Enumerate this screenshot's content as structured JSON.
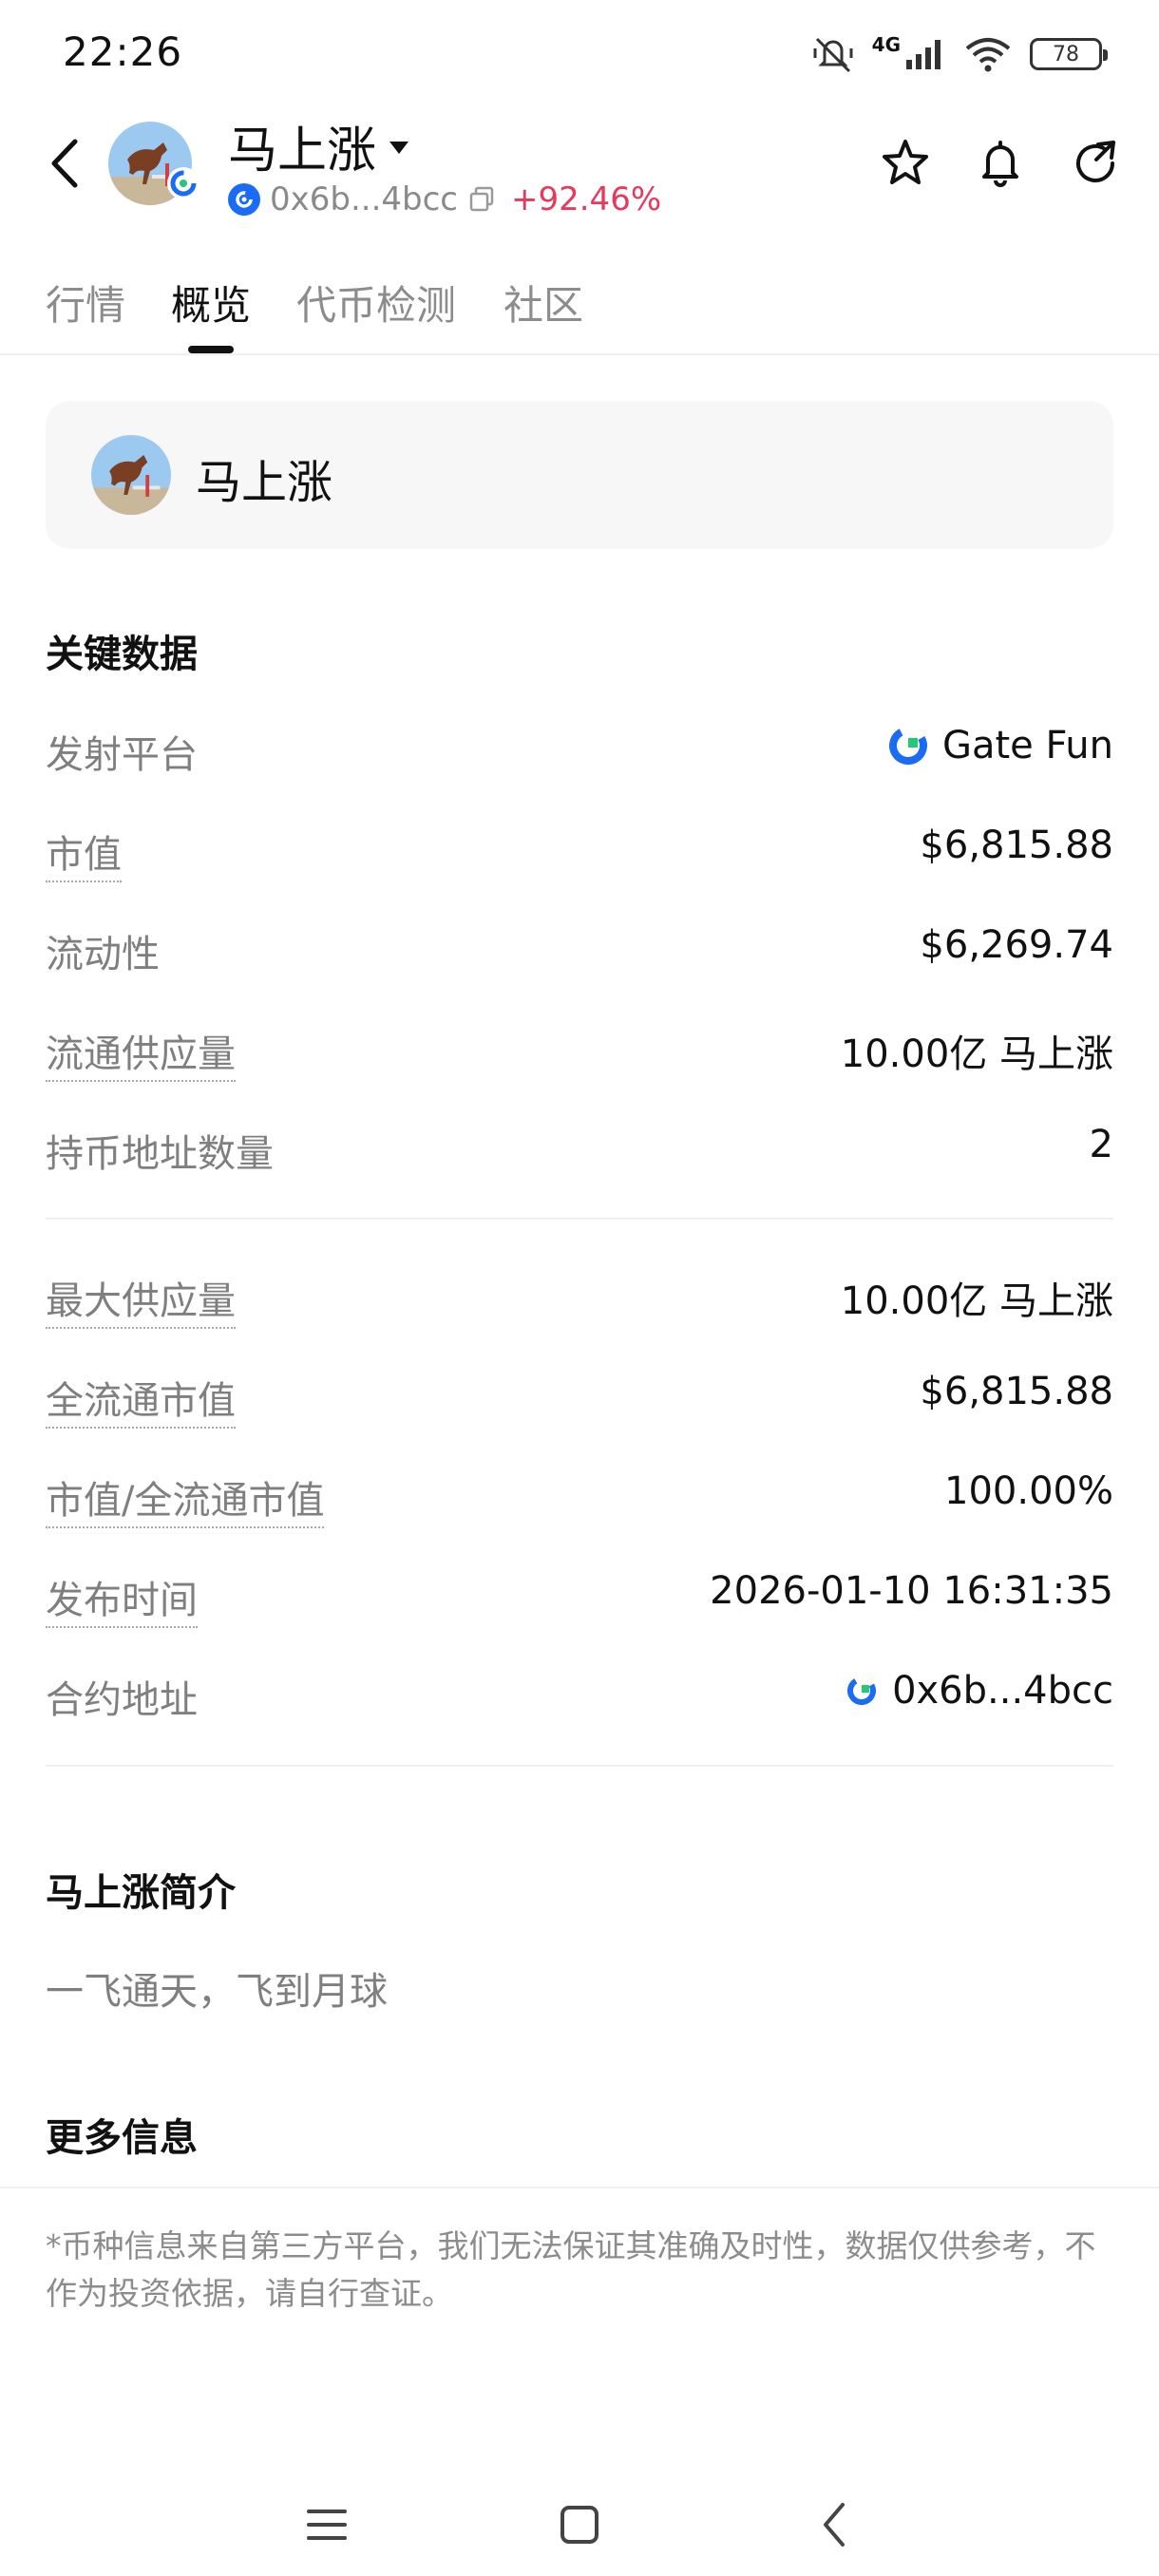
{
  "status_bar": {
    "time": "22:26",
    "network": "4G",
    "battery": "78"
  },
  "header": {
    "token_name": "马上涨",
    "contract_short": "0x6b...4bcc",
    "change": "+92.46%"
  },
  "tabs": [
    {
      "label": "行情"
    },
    {
      "label": "概览"
    },
    {
      "label": "代币检测"
    },
    {
      "label": "社区"
    }
  ],
  "card": {
    "name": "马上涨"
  },
  "key_data": {
    "title": "关键数据",
    "launch_platform": {
      "label": "发射平台",
      "value": "Gate Fun"
    },
    "market_cap": {
      "label": "市值",
      "value": "$6,815.88"
    },
    "liquidity": {
      "label": "流动性",
      "value": "$6,269.74"
    },
    "circulating_supply": {
      "label": "流通供应量",
      "value": "10.00亿 马上涨"
    },
    "holders": {
      "label": "持币地址数量",
      "value": "2"
    },
    "max_supply": {
      "label": "最大供应量",
      "value": "10.00亿 马上涨"
    },
    "fdv": {
      "label": "全流通市值",
      "value": "$6,815.88"
    },
    "mc_fdv_ratio": {
      "label": "市值/全流通市值",
      "value": "100.00%"
    },
    "release_time": {
      "label": "发布时间",
      "value": "2026-01-10 16:31:35"
    },
    "contract": {
      "label": "合约地址",
      "value": "0x6b...4bcc"
    }
  },
  "intro": {
    "title": "马上涨简介",
    "text": "一飞通天，飞到月球"
  },
  "more_info": {
    "title": "更多信息"
  },
  "disclaimer": "*币种信息来自第三方平台，我们无法保证其准确及时性，数据仅供参考，不作为投资依据，请自行查证。",
  "colors": {
    "positive": "#e8385c",
    "chain_blue": "#1a6cf5",
    "gate_green": "#27c77a"
  },
  "icons": [
    "back-icon",
    "dropdown-caret-icon",
    "copy-icon",
    "star-icon",
    "bell-icon",
    "share-icon",
    "gate-fun-icon",
    "chain-icon",
    "menu-icon",
    "home-icon",
    "back-nav-icon"
  ]
}
